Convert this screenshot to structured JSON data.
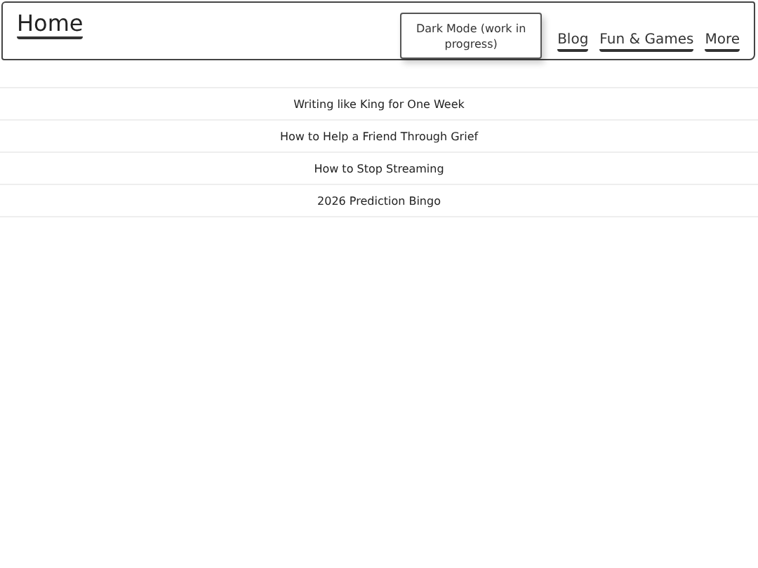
{
  "header": {
    "home": "Home",
    "mode_button": "Dark Mode (work in progress)",
    "nav": [
      "Blog",
      "Fun & Games",
      "More"
    ]
  },
  "posts": [
    "Writing like King for One Week",
    "How to Help a Friend Through Grief",
    "How to Stop Streaming",
    "2026 Prediction Bingo"
  ]
}
